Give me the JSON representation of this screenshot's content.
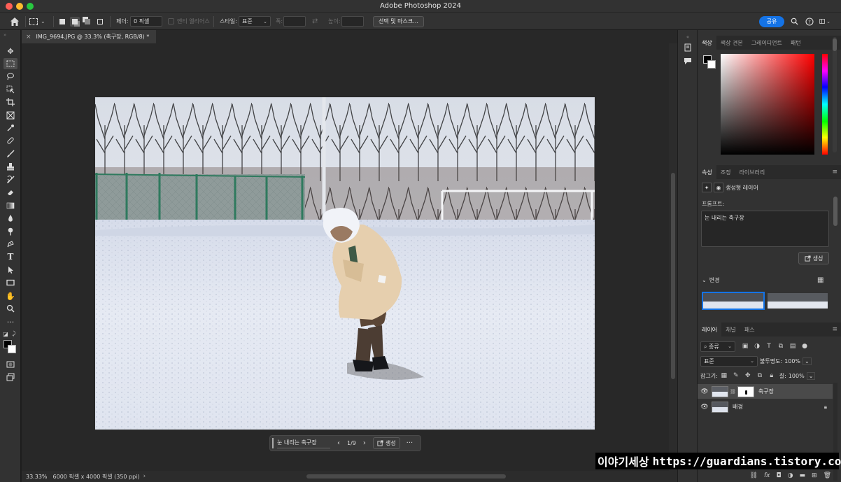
{
  "window": {
    "title": "Adobe Photoshop 2024"
  },
  "options_bar": {
    "feather_label": "페더:",
    "feather_value": "0 픽셀",
    "anti_alias_label": "앤티 앨리어스",
    "style_label": "스타일:",
    "style_value": "표준",
    "width_label": "폭:",
    "height_label": "높이:",
    "select_mask_label": "선택 및 마스크...",
    "share_label": "공유"
  },
  "document": {
    "tab_title": "IMG_9694.JPG @ 33.3% (축구장, RGB/8) *",
    "zoom": "33.33%",
    "dimensions": "6000 픽셀 x 4000 픽셀 (350 ppi)"
  },
  "task_bar": {
    "prompt": "눈 내리는 축구장",
    "page_indicator": "1/9",
    "generate_label": "생성",
    "prev_icon": "‹",
    "next_icon": "›",
    "more_icon": "···"
  },
  "color_panel": {
    "tabs": [
      "색상",
      "색상 견본",
      "그레이디언트",
      "패턴"
    ],
    "foreground": "#000000",
    "background": "#ffffff",
    "hue": "#ff0000"
  },
  "properties_panel": {
    "tabs": [
      "속성",
      "조정",
      "라이브러리"
    ],
    "layer_type": "생성형 레이어",
    "prompt_label": "프롬프트:",
    "prompt_value": "눈 내리는 축구장",
    "generate_label": "생성",
    "variations_label": "변경"
  },
  "layers_panel": {
    "tabs": [
      "레이어",
      "채널",
      "패스"
    ],
    "filter_label": "종류",
    "blend_mode": "표준",
    "opacity_label": "불투명도:",
    "opacity_value": "100%",
    "lock_label": "잠그기:",
    "fill_label": "칠:",
    "fill_value": "100%",
    "layers": [
      {
        "name": "축구장",
        "selected": true,
        "locked": false
      },
      {
        "name": "배경",
        "selected": false,
        "locked": true
      }
    ]
  },
  "watermark": {
    "text": "이야기세상"
  }
}
